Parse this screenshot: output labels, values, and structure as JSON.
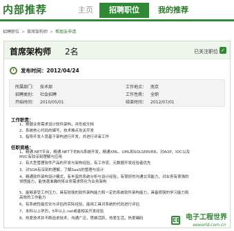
{
  "header": {
    "brand": "内部推荐",
    "tabs": [
      {
        "label": "主页"
      },
      {
        "label": "招聘职位"
      },
      {
        "label": "我的推荐"
      }
    ]
  },
  "breadcrumb": {
    "items": [
      "招聘职位",
      "首席架构师",
      "帮朋友申请"
    ]
  },
  "job": {
    "title": "首席架构师",
    "count": "2名",
    "applied_label": "已关注职位",
    "publish_label": "发布时间：2012/04/24"
  },
  "info": {
    "dept_label": "所属部门：",
    "dept": "技术部",
    "type_label": "招聘类别：",
    "type": "社会招聘",
    "start_label": "开始时间：",
    "start": "2010/05/01",
    "place_label": "工作地点：",
    "place": "南京",
    "nature_label": "工作性质：",
    "nature": "全职",
    "end_label": "结束时间：",
    "end": "2012/07/01"
  },
  "duties": {
    "heading": "工作职责：",
    "items": [
      "1、根据业务需求设计软件架构，并形成文档",
      "2、系统核心代码的编写，技术难点攻关开发",
      "3、指导开发人员基于架构进行开发，并进行评审工作"
    ]
  },
  "requirements": {
    "heading": "任职资格：",
    "items": [
      "1、精通.NET平台，精通.NET下的B/S系统开发，精通XML、UML和SQLSERVER，对AOP、IOC以及MVC有较深刻理解与应用",
      "2、有大型管理软件产品的开发与架构经验，有工作流、元数据开发经验者优先",
      "3、对SOA有深刻的理解，了解SaaS的管理与设计",
      "4、精通软件架构设计模式，有丰富的系统分析与设计经验，有很好的沟通交流能力，对业务有很强的领悟能力，能快速准确的将业务需求转化为业务架构",
      "5、能够承受工作压力，具有较强的软件架构能力和一定的系统软件架构能力，具备很强的学习能力和高效的工作能力",
      "6、有系统性能优化与评估的实际经验，能用工具对系统的代码进行评估",
      "7、本科以上学历，5年以上.net或者相关开发经验",
      "8、热爱技术并不断追求技术，沟通广泛，思维活跃，热爱生活，热爱编码"
    ]
  },
  "watermark": {
    "name": "电子工程世界",
    "url": "eeworld.com.cn",
    "logo": "EE"
  },
  "colors": {
    "brand_green": "#2f8a33",
    "title_bg": "#eef5ea"
  }
}
